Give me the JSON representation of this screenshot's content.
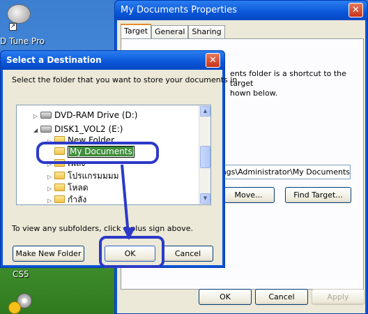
{
  "desktop": {
    "hd_tune_label": "D Tune Pro",
    "cs5_label": "CS5"
  },
  "properties": {
    "title": "My Documents Properties",
    "tabs": [
      {
        "label": "Target",
        "active": true
      },
      {
        "label": "General",
        "active": false
      },
      {
        "label": "Sharing",
        "active": false
      }
    ],
    "target_description": "The My Documents folder is a shortcut to the target folder location shown below.",
    "target_description_visible_l1": "ents folder is a shortcut to the target",
    "target_description_visible_l2": "hown below.",
    "target_value": "ttings\\Administrator\\My Documents",
    "move_label": "Move...",
    "find_target_label": "Find Target...",
    "ok_label": "OK",
    "cancel_label": "Cancel",
    "apply_label": "Apply"
  },
  "dialog": {
    "title": "Select a Destination",
    "instruction": "Select the folder that you want to store your documents in.",
    "tree": [
      {
        "label": "DVD-RAM Drive (D:)",
        "type": "drive"
      },
      {
        "label": "DISK1_VOL2 (E:)",
        "type": "drive"
      },
      {
        "label": "New Folder",
        "type": "folder"
      },
      {
        "label": "My Documents",
        "type": "folder",
        "editing": true
      },
      {
        "label": "เพลง",
        "type": "folder"
      },
      {
        "label": "โปรแกรมมมม",
        "type": "folder"
      },
      {
        "label": "โหลด",
        "type": "folder"
      },
      {
        "label": "กำลัง",
        "type": "folder"
      }
    ],
    "hint": "To view any subfolders, click a plus sign above.",
    "make_new_folder_label": "Make New Folder",
    "ok_label": "OK",
    "cancel_label": "Cancel"
  },
  "colors": {
    "title_bar": "#0a56d8",
    "annotation": "#2c39c8",
    "edit_highlight": "#3e8d3a"
  }
}
